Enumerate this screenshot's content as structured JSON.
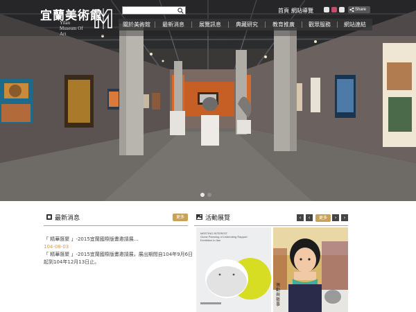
{
  "header": {
    "logo_zh": "宜蘭美術館",
    "logo_en": "Yilan Museum Of Art",
    "search_placeholder": "",
    "top_links": [
      "首頁",
      "網站導覽"
    ],
    "share_label": "Share"
  },
  "nav": {
    "items": [
      "關於美術館",
      "最新消息",
      "展覽訊息",
      "典藏研究",
      "教育推廣",
      "觀眾服務",
      "網站連結"
    ]
  },
  "hero": {
    "slide_count": 2,
    "active_slide": 1
  },
  "news": {
    "title": "最新消息",
    "more_label": "更多",
    "headline": "「 精華匯聚 」-2015宜蘭國際版畫邀請展...",
    "date": "104-08-03",
    "summary_line1": "「 精華匯聚 」-2015宜蘭國際版畫邀請展，展出期間自104年9月6日",
    "summary_line2": "起到104年12月13日止。"
  },
  "events": {
    "title": "活動展覽",
    "more_label": "更多",
    "poster_small_lines": [
      "MEETING INTEREST",
      "Guest Planning of Unbending Rapport",
      "Exhibition in Ilan"
    ],
    "photo_caption": "偶動與藝事"
  },
  "colors": {
    "accent_gold": "#c8a25a",
    "date_orange": "#d99a33",
    "nav_bg": "#373737"
  }
}
